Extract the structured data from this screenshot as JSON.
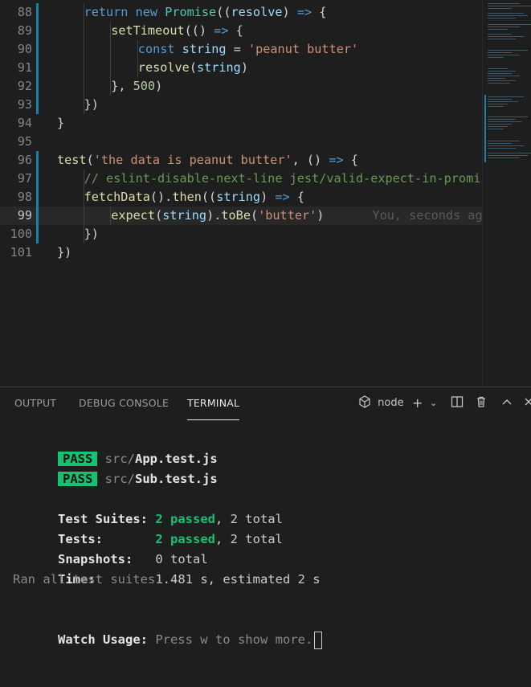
{
  "editor": {
    "lines": [
      {
        "num": "88",
        "tokens": [
          [
            "kw",
            "return "
          ],
          [
            "kw",
            "new "
          ],
          [
            "ty",
            "Promise"
          ],
          [
            "p",
            "(("
          ],
          [
            "var",
            "resolve"
          ],
          [
            "p",
            ") "
          ],
          [
            "kw",
            "=>"
          ],
          [
            "p",
            " {"
          ]
        ]
      },
      {
        "num": "89",
        "tokens": [
          [
            "fn",
            "setTimeout"
          ],
          [
            "p",
            "(() "
          ],
          [
            "kw",
            "=>"
          ],
          [
            "p",
            " {"
          ]
        ]
      },
      {
        "num": "90",
        "tokens": [
          [
            "kw",
            "const "
          ],
          [
            "var",
            "string"
          ],
          [
            "p",
            " = "
          ],
          [
            "str",
            "'peanut butter'"
          ]
        ]
      },
      {
        "num": "91",
        "tokens": [
          [
            "fn",
            "resolve"
          ],
          [
            "p",
            "("
          ],
          [
            "var",
            "string"
          ],
          [
            "p",
            ")"
          ]
        ]
      },
      {
        "num": "92",
        "tokens": [
          [
            "p",
            "}, "
          ],
          [
            "num",
            "500"
          ],
          [
            "p",
            ")"
          ]
        ]
      },
      {
        "num": "93",
        "tokens": [
          [
            "p",
            "})"
          ]
        ]
      },
      {
        "num": "94",
        "tokens": [
          [
            "p",
            "}"
          ]
        ]
      },
      {
        "num": "95",
        "tokens": []
      },
      {
        "num": "96",
        "tokens": [
          [
            "fn",
            "test"
          ],
          [
            "p",
            "("
          ],
          [
            "str",
            "'the data is peanut butter'"
          ],
          [
            "p",
            ", () "
          ],
          [
            "kw",
            "=>"
          ],
          [
            "p",
            " {"
          ]
        ]
      },
      {
        "num": "97",
        "tokens": [
          [
            "cm",
            "// eslint-disable-next-line jest/valid-expect-in-promise"
          ]
        ]
      },
      {
        "num": "98",
        "tokens": [
          [
            "fn",
            "fetchData"
          ],
          [
            "p",
            "()."
          ],
          [
            "fn",
            "then"
          ],
          [
            "p",
            "(("
          ],
          [
            "var",
            "string"
          ],
          [
            "p",
            ") "
          ],
          [
            "kw",
            "=>"
          ],
          [
            "p",
            " {"
          ]
        ]
      },
      {
        "num": "99",
        "tokens": [
          [
            "fn",
            "expect"
          ],
          [
            "p",
            "("
          ],
          [
            "var",
            "string"
          ],
          [
            "p",
            ")."
          ],
          [
            "fn",
            "toBe"
          ],
          [
            "p",
            "("
          ],
          [
            "str",
            "'butter'"
          ],
          [
            "p",
            ")"
          ]
        ]
      },
      {
        "num": "100",
        "tokens": [
          [
            "p",
            "})"
          ]
        ]
      },
      {
        "num": "101",
        "tokens": [
          [
            "p",
            "})"
          ]
        ]
      }
    ],
    "blame": "You, seconds ago • U"
  },
  "panel": {
    "tabs": [
      {
        "label": "OUTPUT"
      },
      {
        "label": "DEBUG CONSOLE"
      },
      {
        "label": "TERMINAL"
      }
    ],
    "terminal_name": "node"
  },
  "terminal": {
    "pass_label": "PASS",
    "results": [
      {
        "dir": "src/",
        "file": "App.test.js"
      },
      {
        "dir": "src/",
        "file": "Sub.test.js"
      }
    ],
    "suites_label": "Test Suites:",
    "suites_passed": "2 passed",
    "suites_total": ", 2 total",
    "tests_label": "Tests:",
    "tests_passed": "2 passed",
    "tests_total": ", 2 total",
    "snapshots_label": "Snapshots:",
    "snapshots_value": "0 total",
    "time_label": "Time:",
    "time_value": "1.481 s, estimated 2 s",
    "ran_all": "Ran all test suites.",
    "watch_label": "Watch Usage:",
    "watch_text": " Press w to show more."
  }
}
